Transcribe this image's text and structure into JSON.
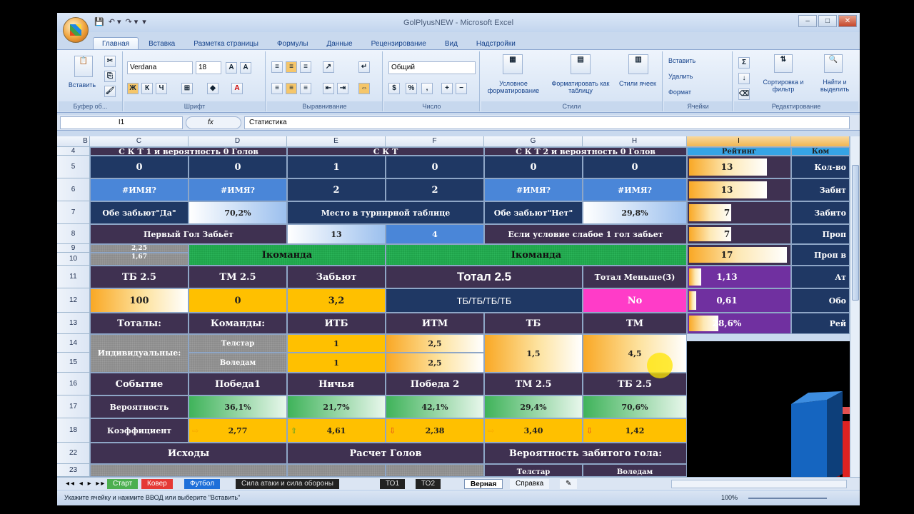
{
  "window": {
    "title": "GolPlyusNEW - Microsoft Excel",
    "buttons": [
      "–",
      "□",
      "✕"
    ]
  },
  "qat": [
    "💾",
    "↶ ▾",
    "↷ ▾",
    "▾"
  ],
  "ribbon": {
    "tabs": [
      "Главная",
      "Вставка",
      "Разметка страницы",
      "Формулы",
      "Данные",
      "Рецензирование",
      "Вид",
      "Надстройки"
    ],
    "paste": "Вставить",
    "clipboard": "Буфер об...",
    "font_name": "Verdana",
    "font_size": "18",
    "font_group": "Шрифт",
    "align_group": "Выравнивание",
    "number_format": "Общий",
    "number_group": "Число",
    "cond_format": "Условное форматирование",
    "format_table": "Форматировать как таблицу",
    "cell_styles": "Стили ячеек",
    "styles_group": "Стили",
    "insert": "Вставить",
    "delete": "Удалить",
    "format": "Формат",
    "cells_group": "Ячейки",
    "sort": "Сортировка и фильтр",
    "find": "Найти и выделить",
    "edit_group": "Редактирование"
  },
  "formula_bar": {
    "name_box": "I1",
    "fx": "fx",
    "content": "Статистика"
  },
  "columns": [
    "B",
    "C",
    "D",
    "E",
    "F",
    "G",
    "H",
    "I",
    ""
  ],
  "rows": [
    "4",
    "5",
    "6",
    "7",
    "8",
    "9",
    "10",
    "11",
    "12",
    "13",
    "14",
    "15",
    "16",
    "17",
    "18",
    "22",
    "23"
  ],
  "top_partial": {
    "c4a": "С К Т 1 и вероятность 0 Голов",
    "c4b": "С К Т",
    "c4c": "С К Т 2 и вероятность 0 Голов",
    "i4": "Рейтинг",
    "j4": "Ком"
  },
  "r5": [
    "0",
    "0",
    "1",
    "0",
    "0",
    "0"
  ],
  "r6": [
    "#ИМЯ?",
    "#ИМЯ?",
    "2",
    "2",
    "#ИМЯ?",
    "#ИМЯ?"
  ],
  "r7": {
    "a": "Обе забьют\"Да\"",
    "b": "70,2%",
    "c": "Место в турнирной таблице",
    "d": "Обе забьют\"Нет\"",
    "e": "29,8%"
  },
  "r8": {
    "a": "Первый Гол Забьёт",
    "b": "13",
    "c": "4",
    "d": "Если условие слабое 1 гол забьет"
  },
  "r9": {
    "a": "2,25",
    "b": "1,67",
    "team1": "Iкоманда",
    "team2": "Iкоманда"
  },
  "r11": [
    "ТБ 2.5",
    "ТМ 2.5",
    "Забьют",
    "Тотал 2.5",
    "Тотал Меньше(3)"
  ],
  "r12": [
    "100",
    "0",
    "3,2",
    "ТБ/ТБ/ТБ/ТБ",
    "No"
  ],
  "r13": [
    "Тоталы:",
    "Команды:",
    "ИТБ",
    "ИТМ",
    "ТБ",
    "ТМ"
  ],
  "r14": {
    "label": "Индивидуальные:",
    "team1": "Телстар",
    "itb1": "1",
    "itm1": "2,5",
    "tb": "1,5",
    "tm": "4,5"
  },
  "r15": {
    "team2": "Воледам",
    "itb2": "1",
    "itm2": "2,5"
  },
  "r16": [
    "Событие",
    "Победа1",
    "Ничья",
    "Победа 2",
    "ТМ 2.5",
    "ТБ 2.5"
  ],
  "r17": {
    "label": "Вероятность",
    "v": [
      "36,1%",
      "21,7%",
      "42,1%",
      "29,4%",
      "70,6%"
    ]
  },
  "r18": {
    "label": "Коэффициент",
    "v": [
      "2,77",
      "4,61",
      "2,38",
      "3,40",
      "1,42"
    ],
    "arrows": [
      "⇨",
      "⇧",
      "⇩",
      "⇨",
      "⇩"
    ]
  },
  "r22": [
    "Исходы",
    "Расчет Голов",
    "Вероятность забитого гола:"
  ],
  "r23": [
    "Телстар",
    "Воледам"
  ],
  "rating": {
    "values": [
      "13",
      "13",
      "7",
      "7",
      "17",
      "1,13",
      "0,61",
      "28,6%"
    ],
    "fill": [
      0.78,
      0.78,
      0.42,
      0.42,
      0.98,
      0.12,
      0.07,
      0.29
    ]
  },
  "side_labels": [
    "Кол-во",
    "Забит",
    "Забито",
    "Проп",
    "Проп в",
    "Ат",
    "Обо",
    "Рей"
  ],
  "sheet_tabs": [
    "Старт",
    "Ковер",
    "Футбол",
    "Сила атаки и сила обороны",
    "ТО1",
    "ТО2",
    "Верная",
    "Справка"
  ],
  "status": "Укажите ячейку и нажмите ВВОД или выберите \"Вставить\"",
  "zoom": "100%"
}
